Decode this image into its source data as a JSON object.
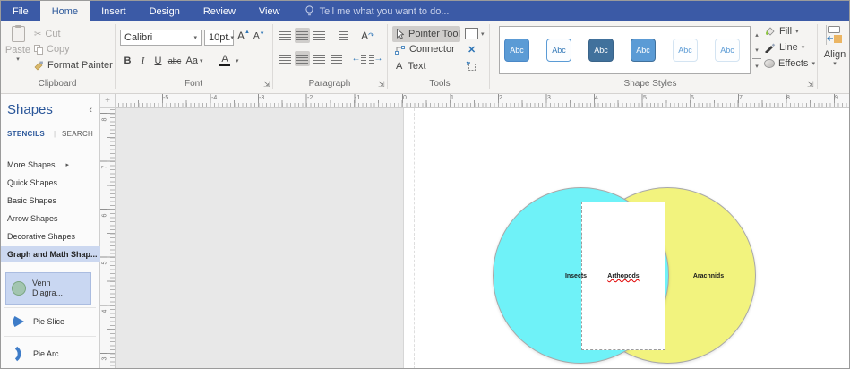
{
  "window": {
    "accent_color": "#3B5AA6",
    "active_tab_color": "#2B579A"
  },
  "tabs": {
    "file": "File",
    "home": "Home",
    "insert": "Insert",
    "design": "Design",
    "review": "Review",
    "view": "View",
    "tell_me": "Tell me what you want to do..."
  },
  "ribbon": {
    "clipboard": {
      "label": "Clipboard",
      "paste": "Paste",
      "cut": "Cut",
      "copy": "Copy",
      "format_painter": "Format Painter"
    },
    "font": {
      "label": "Font",
      "family": "Calibri",
      "size": "10pt.",
      "bold": "B",
      "italic": "I",
      "underline": "U",
      "strikethrough": "abc",
      "change_case": "Aa",
      "font_color": "A",
      "grow": "A",
      "shrink": "A"
    },
    "paragraph": {
      "label": "Paragraph",
      "rotate_text": "A"
    },
    "tools": {
      "label": "Tools",
      "pointer": "Pointer Tool",
      "connector": "Connector",
      "text": "Text",
      "text_icon": "A"
    },
    "shape_styles": {
      "label": "Shape Styles",
      "swatches": [
        {
          "label": "Abc",
          "fill": "#5B9BD5"
        },
        {
          "label": "Abc",
          "fill": "#FFFFFF"
        },
        {
          "label": "Abc",
          "fill": "#41719C"
        },
        {
          "label": "Abc",
          "fill": "#5B9BD5"
        },
        {
          "label": "Abc",
          "fill": "#FDFEFF"
        },
        {
          "label": "Abc",
          "fill": "#FDFEFF"
        }
      ]
    },
    "style_buttons": {
      "fill": "Fill",
      "line": "Line",
      "effects": "Effects"
    },
    "arrange": {
      "align": "Align"
    }
  },
  "shapes_panel": {
    "title": "Shapes",
    "tabs": {
      "stencils": "STENCILS",
      "search": "SEARCH",
      "divider": "|"
    },
    "sections": [
      "More Shapes",
      "Quick Shapes",
      "Basic Shapes",
      "Arrow Shapes",
      "Decorative Shapes",
      "Graph and Math Shap..."
    ],
    "masters": [
      {
        "name": "Venn Diagra...",
        "selected": true
      },
      {
        "name": "Pie Slice",
        "selected": false
      },
      {
        "name": "Pie Arc",
        "selected": false
      }
    ]
  },
  "rulers": {
    "horizontal": [
      "-5",
      "-4",
      "-3",
      "-2",
      "-1",
      "0",
      "1",
      "2",
      "3",
      "4",
      "5",
      "6",
      "7",
      "8",
      "9"
    ],
    "vertical": [
      "8",
      "7",
      "6",
      "5",
      "4",
      "3"
    ]
  },
  "canvas": {
    "venn": {
      "left_label": "Insects",
      "middle_label": "Arthopods",
      "right_label": "Arachnids",
      "left_fill": "#6FF2F8",
      "right_fill": "#F2F37E",
      "middle_misspelled": true
    }
  },
  "icons": {
    "dropdown": "▾",
    "up_scroll": "▴",
    "collapse_chevron": "‹",
    "expand_arrow": "▸",
    "scissors": "✂",
    "connection_x": "✕",
    "launcher": "⇲",
    "origin_cross": "+",
    "indent_left": "←",
    "indent_right": "→",
    "rotate_arrow": "↷"
  }
}
